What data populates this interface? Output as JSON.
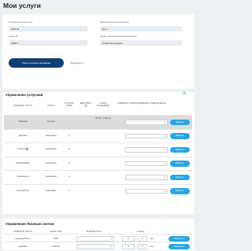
{
  "page": {
    "title": "Мои услуги"
  },
  "info": {
    "account_label": "Остаток на Личном счете",
    "account_value": "1200.00",
    "contract_label": "Номер абонентского договора",
    "contract_value": "90+1",
    "id_label": "Номер ID",
    "id_value": "482871",
    "manager_label": "Тариф управляемым абонентом связи",
    "manager_value": "Обмен Мессенджер",
    "button_label": "Повтор номера активации",
    "more_link": "Подробнее ▾"
  },
  "services": {
    "title": "Управление услугами",
    "refresh_icon": "refresh-icon",
    "headers": [
      "НАЗВАНИЕ УСЛУГИ",
      "СТАТУС",
      "ОСТАТОК ДНЕЙ",
      "ДЕЙСТВУЕТ ДО",
      "ТАРИФ ПРОДЛЕНИЯ",
      "ИЗМЕНИТЬ ТАРИФ ПРОДЛЕНИЯ / ПОДКЛЮЧЕНИЯ"
    ],
    "rows": [
      {
        "name": "Базовый",
        "status": "Активна",
        "days": "",
        "until": "",
        "tariff": "100 руб. / 1200 руб.",
        "select": "",
        "action": "Выбрать",
        "highlight": true
      },
      {
        "name": "Детский",
        "status": "Неактивна",
        "days": "0",
        "until": "",
        "tariff": "",
        "select": "",
        "action": "Выбрать",
        "highlight": false
      },
      {
        "name": "Личный",
        "status": "Неактивна",
        "days": "0",
        "until": "",
        "tariff": "",
        "select": "",
        "action": "Выбрать",
        "highlight": false,
        "info": true
      },
      {
        "name": "АНТИ-КРАЖА",
        "status": "Неактивна",
        "days": "0",
        "until": "",
        "tariff": "",
        "select": "",
        "action": "Выбрать",
        "highlight": false
      },
      {
        "name": "Умн.Фильтр",
        "status": "Неактивна",
        "days": "0",
        "until": "",
        "tariff": "",
        "select": "",
        "action": "Выбрать",
        "highlight": false
      },
      {
        "name": "Анти-Бутбол",
        "status": "Неактивна",
        "days": "0",
        "until": "",
        "tariff": "",
        "select": "",
        "action": "Выбрать",
        "highlight": false
      }
    ]
  },
  "accounts": {
    "title": "Управление Личным счетом",
    "headers": [
      "НАЗВАНИЕ УСЛУГИ",
      "СУММА, РУБ.",
      "ПЕРЕНЕСТИ НА",
      "СУММА"
    ],
    "rows": [
      {
        "name": "Надежный счет",
        "amount": "1000",
        "target": "",
        "rub": "0",
        "kop": "0",
        "unit": "коп.",
        "action": "Перенести"
      },
      {
        "name": "Единый",
        "amount": "1200.00",
        "target": "",
        "rub": "0",
        "kop": "0",
        "unit": "коп.",
        "action": "Перенести"
      }
    ]
  }
}
